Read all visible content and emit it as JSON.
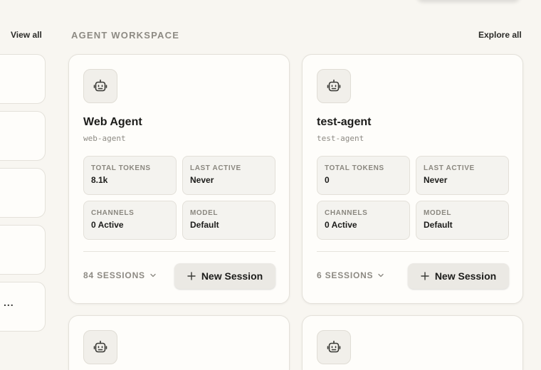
{
  "left_panel": {
    "view_all_label": "View all",
    "truncated_item": "..."
  },
  "workspace": {
    "title": "AGENT WORKSPACE",
    "explore_all_label": "Explore all",
    "agents": [
      {
        "name": "Web Agent",
        "slug": "web-agent",
        "stats": {
          "total_tokens_label": "TOTAL TOKENS",
          "total_tokens": "8.1k",
          "last_active_label": "LAST ACTIVE",
          "last_active": "Never",
          "channels_label": "CHANNELS",
          "channels": "0 Active",
          "model_label": "MODEL",
          "model": "Default"
        },
        "sessions_label": "84 SESSIONS",
        "new_session_label": "New Session"
      },
      {
        "name": "test-agent",
        "slug": "test-agent",
        "stats": {
          "total_tokens_label": "TOTAL TOKENS",
          "total_tokens": "0",
          "last_active_label": "LAST ACTIVE",
          "last_active": "Never",
          "channels_label": "CHANNELS",
          "channels": "0 Active",
          "model_label": "MODEL",
          "model": "Default"
        },
        "sessions_label": "6 SESSIONS",
        "new_session_label": "New Session"
      }
    ]
  },
  "icons": {
    "agent": "robot-icon",
    "sessions_toggle": "chevron-down-icon",
    "new_session": "plus-icon"
  },
  "colors": {
    "background": "#f8f6f1",
    "card": "#fefdfa",
    "muted_text": "#8d8a83"
  }
}
